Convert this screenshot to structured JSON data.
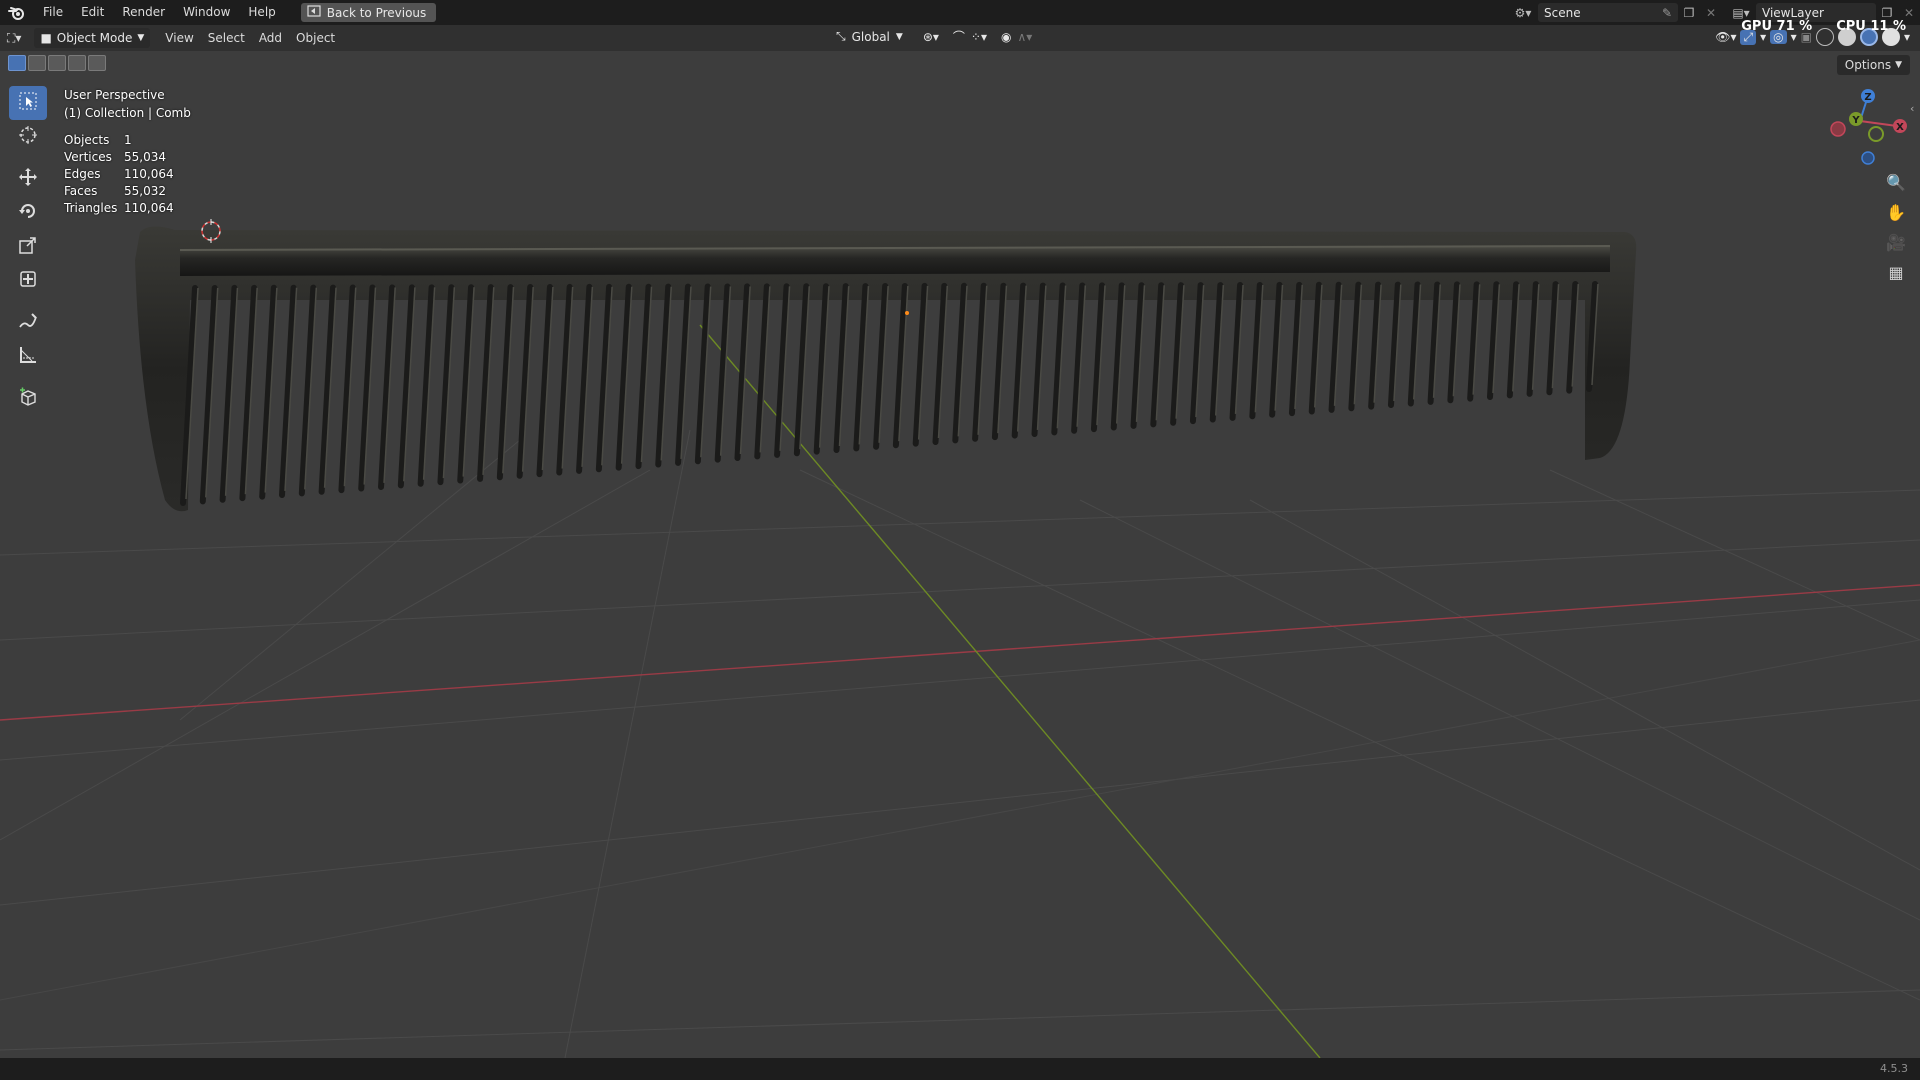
{
  "menu": {
    "items": [
      "File",
      "Edit",
      "Render",
      "Window",
      "Help"
    ],
    "back_button": "Back to Previous"
  },
  "top_right": {
    "scene": "Scene",
    "view_layer": "ViewLayer",
    "gpu": "GPU 71 %",
    "cpu": "CPU 11 %"
  },
  "header": {
    "mode": "Object Mode",
    "menus": [
      "View",
      "Select",
      "Add",
      "Object"
    ],
    "transform_orientation": "Global",
    "options": "Options"
  },
  "overlay": {
    "view_name": "User Perspective",
    "collection": "(1) Collection | Comb",
    "stats": [
      {
        "label": "Objects",
        "value": "1"
      },
      {
        "label": "Vertices",
        "value": "55,034"
      },
      {
        "label": "Edges",
        "value": "110,064"
      },
      {
        "label": "Faces",
        "value": "55,032"
      },
      {
        "label": "Triangles",
        "value": "110,064"
      }
    ]
  },
  "gizmo": {
    "x": "X",
    "y": "Y",
    "z": "Z"
  },
  "colors": {
    "accent": "#4772b3",
    "x_axis": "#c3475a",
    "y_axis": "#7a9a2a",
    "z_axis": "#3f7fd6",
    "viewport_bg": "#3d3d3d"
  },
  "status": {
    "version": "4.5.3"
  }
}
